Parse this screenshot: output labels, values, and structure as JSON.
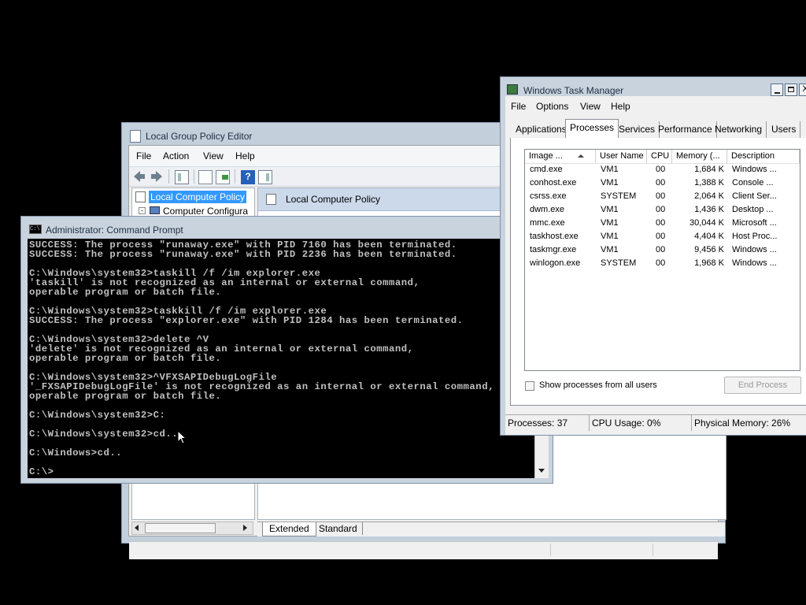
{
  "gpe": {
    "title": "Local Group Policy Editor",
    "menu": [
      "File",
      "Action",
      "View",
      "Help"
    ],
    "tree": {
      "selected": "Local Computer Policy",
      "child": "Computer Configura"
    },
    "main_header": "Local Computer Policy",
    "tabs": [
      "Extended",
      "Standard"
    ]
  },
  "cmd": {
    "title": "Administrator: Command Prompt",
    "lines": [
      "SUCCESS: The process \"runaway.exe\" with PID 7160 has been terminated.",
      "SUCCESS: The process \"runaway.exe\" with PID 2236 has been terminated.",
      "",
      "C:\\Windows\\system32>taskill /f /im explorer.exe",
      "'taskill' is not recognized as an internal or external command,",
      "operable program or batch file.",
      "",
      "C:\\Windows\\system32>taskkill /f /im explorer.exe",
      "SUCCESS: The process \"explorer.exe\" with PID 1284 has been terminated.",
      "",
      "C:\\Windows\\system32>delete ^V",
      "'delete' is not recognized as an internal or external command,",
      "operable program or batch file.",
      "",
      "C:\\Windows\\system32>^VFXSAPIDebugLogFile",
      "'_FXSAPIDebugLogFile' is not recognized as an internal or external command,",
      "operable program or batch file.",
      "",
      "C:\\Windows\\system32>C:",
      "",
      "C:\\Windows\\system32>cd..",
      "",
      "C:\\Windows>cd..",
      "",
      "C:\\>"
    ]
  },
  "tm": {
    "title": "Windows Task Manager",
    "menu": [
      "File",
      "Options",
      "View",
      "Help"
    ],
    "tabs": [
      "Applications",
      "Processes",
      "Services",
      "Performance",
      "Networking",
      "Users"
    ],
    "active_tab": "Processes",
    "columns": [
      "Image ...",
      "User Name",
      "CPU",
      "Memory (...",
      "Description"
    ],
    "rows": [
      [
        "cmd.exe",
        "VM1",
        "00",
        "1,684 K",
        "Windows ..."
      ],
      [
        "conhost.exe",
        "VM1",
        "00",
        "1,388 K",
        "Console ..."
      ],
      [
        "csrss.exe",
        "SYSTEM",
        "00",
        "2,064 K",
        "Client Ser..."
      ],
      [
        "dwm.exe",
        "VM1",
        "00",
        "1,436 K",
        "Desktop ..."
      ],
      [
        "mmc.exe",
        "VM1",
        "00",
        "30,044 K",
        "Microsoft ..."
      ],
      [
        "taskhost.exe",
        "VM1",
        "00",
        "4,404 K",
        "Host Proc..."
      ],
      [
        "taskmgr.exe",
        "VM1",
        "00",
        "9,456 K",
        "Windows ..."
      ],
      [
        "winlogon.exe",
        "SYSTEM",
        "00",
        "1,968 K",
        "Windows ..."
      ]
    ],
    "show_all_label": "Show processes from all users",
    "end_process_label": "End Process",
    "status": [
      "Processes: 37",
      "CPU Usage: 0%",
      "Physical Memory: 26%"
    ]
  },
  "colors": {
    "selection": "#3399ff",
    "console_text": "#c0c0c0",
    "desktop": "#000000"
  }
}
